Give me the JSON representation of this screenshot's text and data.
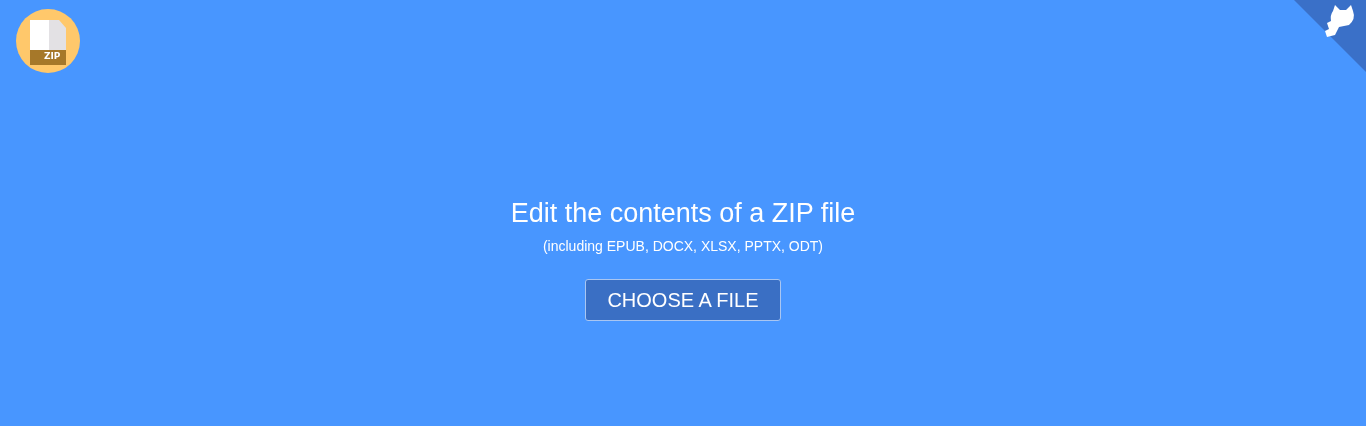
{
  "logo": {
    "label": "ZIP"
  },
  "heading": "Edit the contents of a ZIP file",
  "subheading": "(including EPUB, DOCX, XLSX, PPTX, ODT)",
  "button": "CHOOSE A FILE"
}
